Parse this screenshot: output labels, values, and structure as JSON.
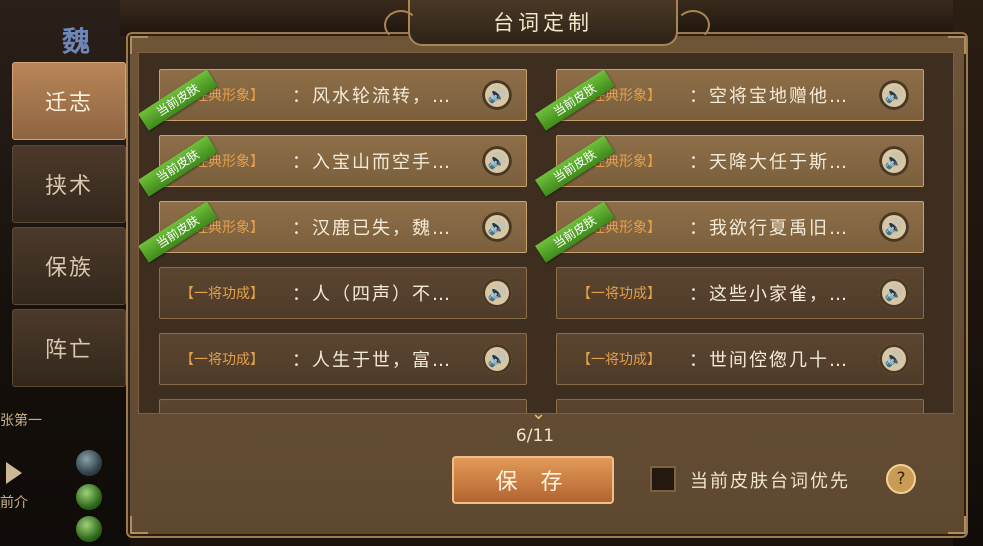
{
  "background": {
    "faction": "魏",
    "fragments": [
      "张第一",
      "前介"
    ]
  },
  "side_tabs": [
    {
      "label": "迁志",
      "active": true
    },
    {
      "label": "挟术",
      "active": false
    },
    {
      "label": "保族",
      "active": false
    },
    {
      "label": "阵亡",
      "active": false
    }
  ],
  "dialog": {
    "title": "台词定制",
    "ribbon_label": "当前皮肤",
    "speaker_icon": "speaker-icon",
    "lines_left": [
      {
        "tag": "【经典形象】",
        "text": "：风水轮流转，…",
        "current_skin": true
      },
      {
        "tag": "【经典形象】",
        "text": "：入宝山而空手…",
        "current_skin": true
      },
      {
        "tag": "【经典形象】",
        "text": "：汉鹿已失，魏…",
        "current_skin": true
      },
      {
        "tag": "【一将功成】",
        "text": "：人（四声）不…",
        "current_skin": false
      },
      {
        "tag": "【一将功成】",
        "text": "：人生于世，富…",
        "current_skin": false
      }
    ],
    "lines_right": [
      {
        "tag": "【经典形象】",
        "text": "：空将宝地赠他…",
        "current_skin": true
      },
      {
        "tag": "【经典形象】",
        "text": "：天降大任于斯…",
        "current_skin": true
      },
      {
        "tag": "【经典形象】",
        "text": "：我欲行夏禹旧…",
        "current_skin": true
      },
      {
        "tag": "【一将功成】",
        "text": "：这些小家雀，…",
        "current_skin": false
      },
      {
        "tag": "【一将功成】",
        "text": "：世间倥偬几十…",
        "current_skin": false
      }
    ],
    "page_counter": "6/11",
    "save_label": "保 存",
    "priority_label": "当前皮肤台词优先",
    "priority_checked": false,
    "help_label": "?"
  },
  "colors": {
    "tag_orange": "#e3a04a",
    "ribbon_green": "#4f9f26",
    "save_button": "#c97a3f"
  }
}
